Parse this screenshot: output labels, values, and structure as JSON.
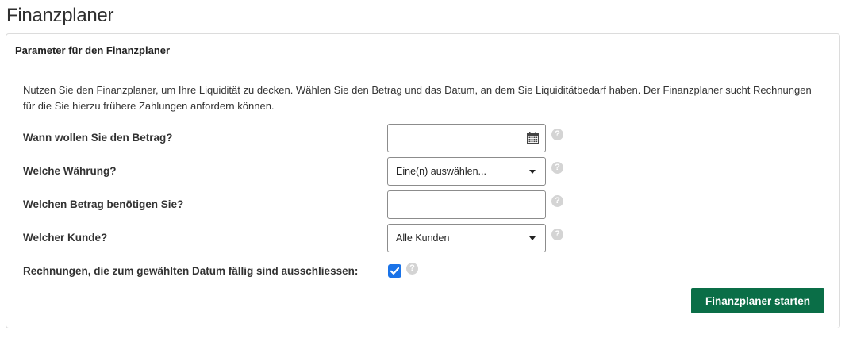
{
  "page": {
    "title": "Finanzplaner"
  },
  "panel": {
    "heading": "Parameter für den Finanzplaner",
    "intro": "Nutzen Sie den Finanzplaner, um Ihre Liquidität zu decken. Wählen Sie den Betrag und das Datum, an dem Sie Liquiditätbedarf haben. Der Finanzplaner sucht Rechnungen für die Sie hierzu frühere Zahlungen anfordern können."
  },
  "form": {
    "date": {
      "label": "Wann wollen Sie den Betrag?",
      "value": "",
      "icon": "calendar-icon"
    },
    "currency": {
      "label": "Welche Währung?",
      "selected": "Eine(n) auswählen..."
    },
    "amount": {
      "label": "Welchen Betrag benötigen Sie?",
      "value": ""
    },
    "customer": {
      "label": "Welcher Kunde?",
      "selected": "Alle Kunden"
    },
    "exclude_due": {
      "label": "Rechnungen, die zum gewählten Datum fällig sind ausschliessen:",
      "checked": true
    },
    "help_icon_glyph": "?",
    "submit_label": "Finanzplaner starten"
  },
  "colors": {
    "primary_button": "#0a6e47",
    "checkbox": "#1a73e8",
    "help_icon": "#d4d4d4"
  }
}
